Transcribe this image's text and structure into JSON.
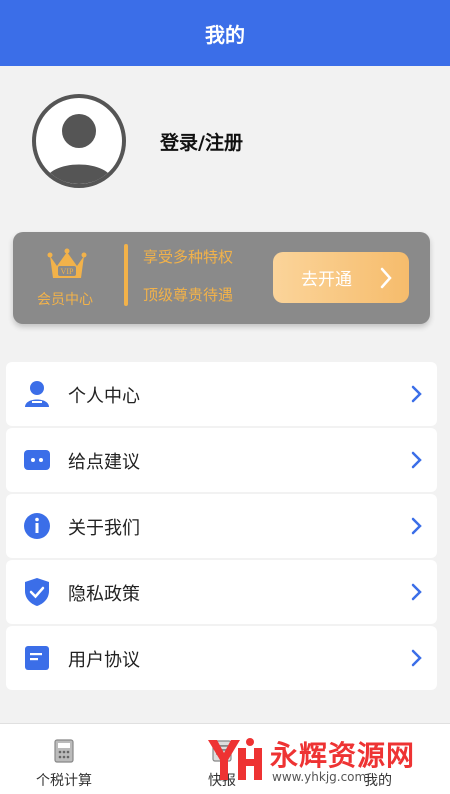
{
  "header": {
    "title": "我的"
  },
  "profile": {
    "login_label": "登录/注册"
  },
  "vip": {
    "badge_label": "会员中心",
    "badge_text": "VIP",
    "benefit_1": "享受多种特权",
    "benefit_2": "顶级尊贵待遇",
    "button_label": "去开通",
    "accent_color": "#f2b24a"
  },
  "menu": [
    {
      "label": "个人中心",
      "icon": "person-icon"
    },
    {
      "label": "给点建议",
      "icon": "chat-icon"
    },
    {
      "label": "关于我们",
      "icon": "info-icon"
    },
    {
      "label": "隐私政策",
      "icon": "shield-check-icon"
    },
    {
      "label": "用户协议",
      "icon": "document-icon"
    }
  ],
  "tabs": [
    {
      "label": "个税计算",
      "icon": "calculator-icon"
    },
    {
      "label": "快报",
      "icon": "news-icon"
    },
    {
      "label": "我的",
      "icon": "user-icon"
    }
  ],
  "watermark": {
    "brand": "永辉资源网",
    "url": "www.yhkjg.com"
  },
  "colors": {
    "primary": "#3b6ee8",
    "vip_card": "#8a8a8a"
  }
}
